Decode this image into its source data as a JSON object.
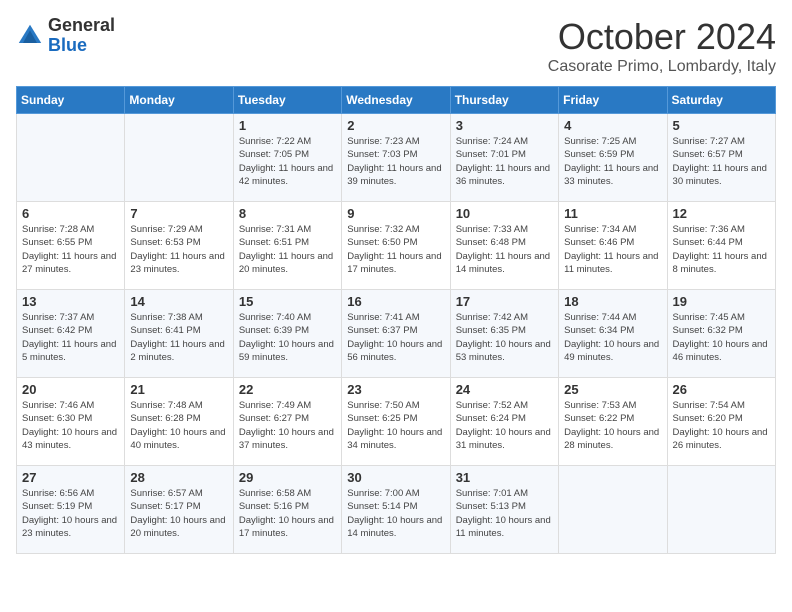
{
  "header": {
    "logo_general": "General",
    "logo_blue": "Blue",
    "month_title": "October 2024",
    "location": "Casorate Primo, Lombardy, Italy"
  },
  "calendar": {
    "days_of_week": [
      "Sunday",
      "Monday",
      "Tuesday",
      "Wednesday",
      "Thursday",
      "Friday",
      "Saturday"
    ],
    "weeks": [
      [
        {
          "day": "",
          "info": ""
        },
        {
          "day": "",
          "info": ""
        },
        {
          "day": "1",
          "info": "Sunrise: 7:22 AM\nSunset: 7:05 PM\nDaylight: 11 hours and 42 minutes."
        },
        {
          "day": "2",
          "info": "Sunrise: 7:23 AM\nSunset: 7:03 PM\nDaylight: 11 hours and 39 minutes."
        },
        {
          "day": "3",
          "info": "Sunrise: 7:24 AM\nSunset: 7:01 PM\nDaylight: 11 hours and 36 minutes."
        },
        {
          "day": "4",
          "info": "Sunrise: 7:25 AM\nSunset: 6:59 PM\nDaylight: 11 hours and 33 minutes."
        },
        {
          "day": "5",
          "info": "Sunrise: 7:27 AM\nSunset: 6:57 PM\nDaylight: 11 hours and 30 minutes."
        }
      ],
      [
        {
          "day": "6",
          "info": "Sunrise: 7:28 AM\nSunset: 6:55 PM\nDaylight: 11 hours and 27 minutes."
        },
        {
          "day": "7",
          "info": "Sunrise: 7:29 AM\nSunset: 6:53 PM\nDaylight: 11 hours and 23 minutes."
        },
        {
          "day": "8",
          "info": "Sunrise: 7:31 AM\nSunset: 6:51 PM\nDaylight: 11 hours and 20 minutes."
        },
        {
          "day": "9",
          "info": "Sunrise: 7:32 AM\nSunset: 6:50 PM\nDaylight: 11 hours and 17 minutes."
        },
        {
          "day": "10",
          "info": "Sunrise: 7:33 AM\nSunset: 6:48 PM\nDaylight: 11 hours and 14 minutes."
        },
        {
          "day": "11",
          "info": "Sunrise: 7:34 AM\nSunset: 6:46 PM\nDaylight: 11 hours and 11 minutes."
        },
        {
          "day": "12",
          "info": "Sunrise: 7:36 AM\nSunset: 6:44 PM\nDaylight: 11 hours and 8 minutes."
        }
      ],
      [
        {
          "day": "13",
          "info": "Sunrise: 7:37 AM\nSunset: 6:42 PM\nDaylight: 11 hours and 5 minutes."
        },
        {
          "day": "14",
          "info": "Sunrise: 7:38 AM\nSunset: 6:41 PM\nDaylight: 11 hours and 2 minutes."
        },
        {
          "day": "15",
          "info": "Sunrise: 7:40 AM\nSunset: 6:39 PM\nDaylight: 10 hours and 59 minutes."
        },
        {
          "day": "16",
          "info": "Sunrise: 7:41 AM\nSunset: 6:37 PM\nDaylight: 10 hours and 56 minutes."
        },
        {
          "day": "17",
          "info": "Sunrise: 7:42 AM\nSunset: 6:35 PM\nDaylight: 10 hours and 53 minutes."
        },
        {
          "day": "18",
          "info": "Sunrise: 7:44 AM\nSunset: 6:34 PM\nDaylight: 10 hours and 49 minutes."
        },
        {
          "day": "19",
          "info": "Sunrise: 7:45 AM\nSunset: 6:32 PM\nDaylight: 10 hours and 46 minutes."
        }
      ],
      [
        {
          "day": "20",
          "info": "Sunrise: 7:46 AM\nSunset: 6:30 PM\nDaylight: 10 hours and 43 minutes."
        },
        {
          "day": "21",
          "info": "Sunrise: 7:48 AM\nSunset: 6:28 PM\nDaylight: 10 hours and 40 minutes."
        },
        {
          "day": "22",
          "info": "Sunrise: 7:49 AM\nSunset: 6:27 PM\nDaylight: 10 hours and 37 minutes."
        },
        {
          "day": "23",
          "info": "Sunrise: 7:50 AM\nSunset: 6:25 PM\nDaylight: 10 hours and 34 minutes."
        },
        {
          "day": "24",
          "info": "Sunrise: 7:52 AM\nSunset: 6:24 PM\nDaylight: 10 hours and 31 minutes."
        },
        {
          "day": "25",
          "info": "Sunrise: 7:53 AM\nSunset: 6:22 PM\nDaylight: 10 hours and 28 minutes."
        },
        {
          "day": "26",
          "info": "Sunrise: 7:54 AM\nSunset: 6:20 PM\nDaylight: 10 hours and 26 minutes."
        }
      ],
      [
        {
          "day": "27",
          "info": "Sunrise: 6:56 AM\nSunset: 5:19 PM\nDaylight: 10 hours and 23 minutes."
        },
        {
          "day": "28",
          "info": "Sunrise: 6:57 AM\nSunset: 5:17 PM\nDaylight: 10 hours and 20 minutes."
        },
        {
          "day": "29",
          "info": "Sunrise: 6:58 AM\nSunset: 5:16 PM\nDaylight: 10 hours and 17 minutes."
        },
        {
          "day": "30",
          "info": "Sunrise: 7:00 AM\nSunset: 5:14 PM\nDaylight: 10 hours and 14 minutes."
        },
        {
          "day": "31",
          "info": "Sunrise: 7:01 AM\nSunset: 5:13 PM\nDaylight: 10 hours and 11 minutes."
        },
        {
          "day": "",
          "info": ""
        },
        {
          "day": "",
          "info": ""
        }
      ]
    ]
  }
}
